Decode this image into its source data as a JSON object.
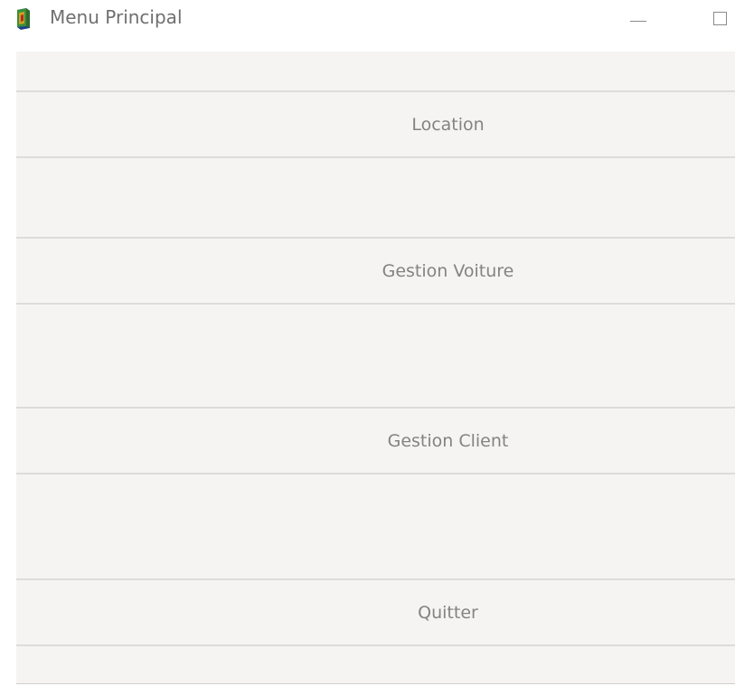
{
  "window": {
    "title": "Menu Principal",
    "icon": "book-icon"
  },
  "menu": {
    "buttons": [
      {
        "label": "Location"
      },
      {
        "label": "Gestion Voiture"
      },
      {
        "label": "Gestion Client"
      },
      {
        "label": "Quitter"
      }
    ]
  },
  "colors": {
    "background": "#f5f4f2",
    "button_text": "#838383",
    "separator": "#dcdcdc"
  }
}
